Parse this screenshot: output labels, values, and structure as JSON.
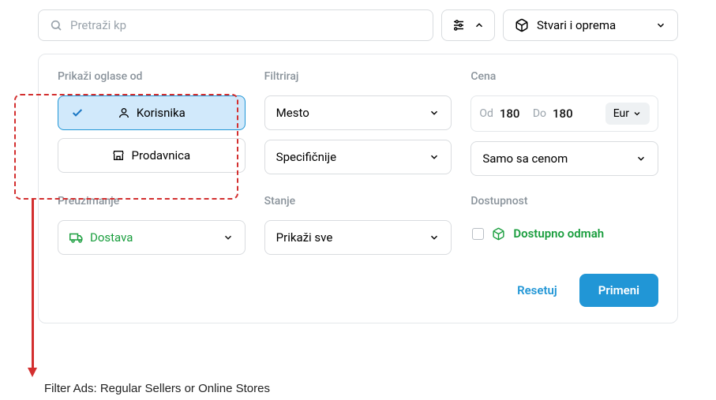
{
  "search": {
    "placeholder": "Pretraži kp"
  },
  "category": {
    "label": "Stvari i oprema"
  },
  "sections": {
    "seller": "Prikaži oglase od",
    "filter": "Filtriraj",
    "price": "Cena",
    "pickup": "Preuzimanje",
    "condition": "Stanje",
    "availability": "Dostupnost"
  },
  "seller_options": {
    "users": "Korisnika",
    "stores": "Prodavnica"
  },
  "filter_dropdowns": {
    "place": "Mesto",
    "specific": "Specifičnije"
  },
  "price": {
    "from_label": "Od",
    "from_value": "180",
    "to_label": "Do",
    "to_value": "180",
    "currency": "Eur",
    "only_with_price": "Samo sa cenom"
  },
  "pickup": {
    "delivery": "Dostava"
  },
  "condition": {
    "show_all": "Prikaži sve"
  },
  "availability": {
    "immediate": "Dostupno odmah"
  },
  "actions": {
    "reset": "Resetuj",
    "apply": "Primeni"
  },
  "caption": "Filter Ads: Regular Sellers or Online Stores"
}
